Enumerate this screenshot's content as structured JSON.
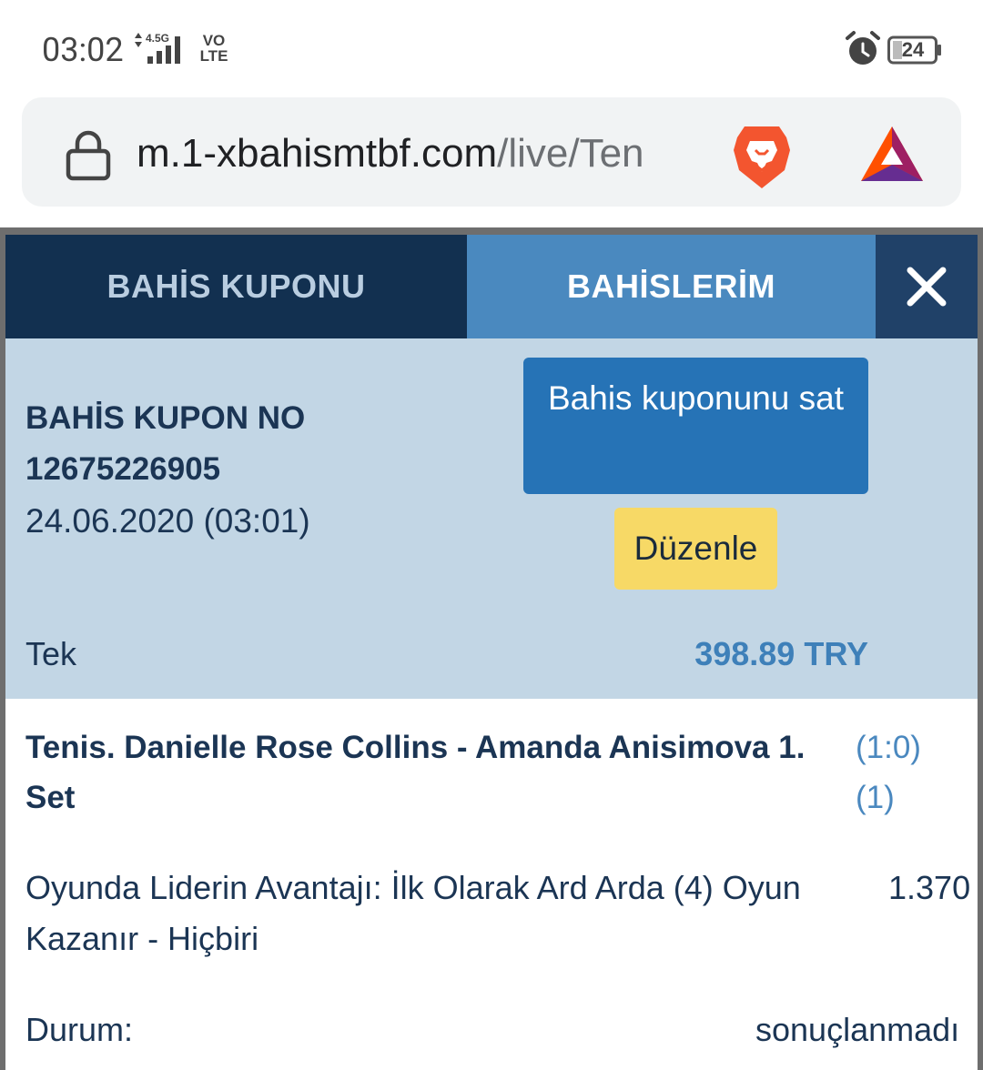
{
  "status_bar": {
    "time": "03:02",
    "network": "4.5G",
    "volte_line1": "VO",
    "volte_line2": "LTE",
    "battery": "24",
    "alarm_icon": "alarm-clock-icon"
  },
  "browser": {
    "url_host": "m.1-xbahismtbf.com",
    "url_path": "/live/Ten",
    "icons": [
      "lock-icon",
      "brave-lion-icon",
      "bat-triangle-icon"
    ]
  },
  "tabs": [
    {
      "label": "BAHİS KUPONU",
      "active": false
    },
    {
      "label": "BAHİSLERİM",
      "active": true
    }
  ],
  "close_icon": "close-icon",
  "coupon": {
    "label": "BAHİS KUPON NO",
    "number": "12675226905",
    "date": "24.06.2020 (03:01)",
    "sell_button": "Bahis kuponunu sat",
    "edit_button": "Düzenle",
    "bet_type": "Tek",
    "amount": "398.89 TRY"
  },
  "event": {
    "title": "Tenis. Danielle Rose Collins - Amanda Anisimova 1. Set",
    "score": "(1:0) (1)",
    "market": "Oyunda Liderin Avantajı: İlk Olarak Ard Arda (4) Oyun Kazanır - Hiçbiri",
    "odds": "1.370",
    "status_label": "Durum:",
    "status_value": "sonuçlanmadı"
  },
  "colors": {
    "tab_inactive_bg": "#123050",
    "tab_active_bg": "#4a89bf",
    "close_bg": "#204168",
    "info_bg": "#c2d6e5",
    "sell_button_bg": "#2673b6",
    "edit_button_bg": "#f7d966",
    "amount_color": "#3e80b9",
    "text_dark": "#1b3554"
  }
}
